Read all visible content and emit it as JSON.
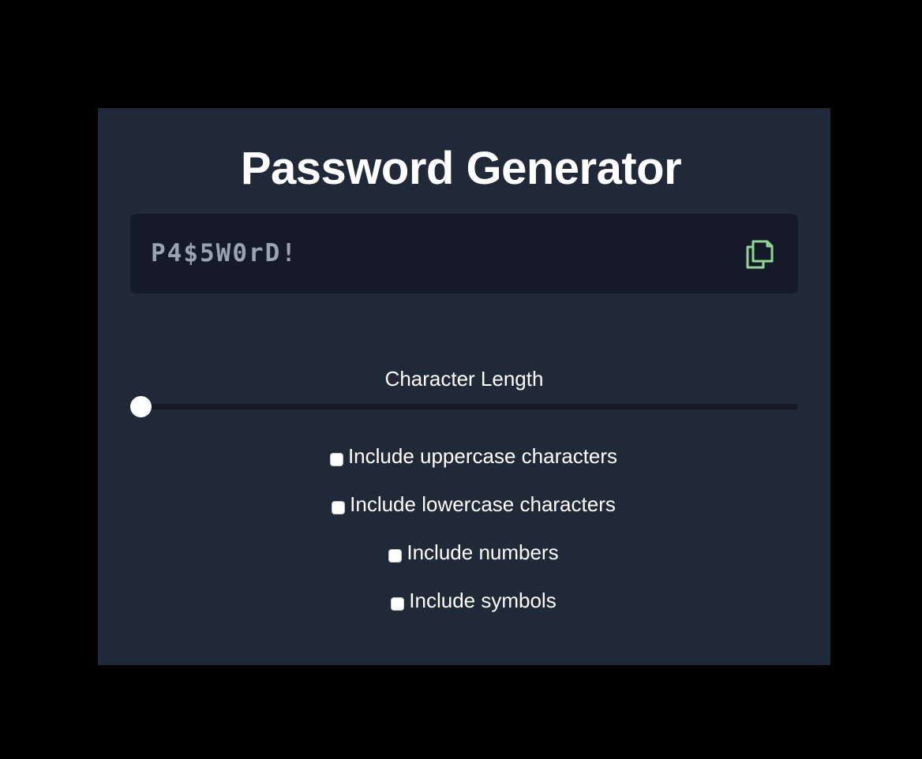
{
  "app": {
    "title": "Password Generator"
  },
  "password": {
    "value": "P4$5W0rD!",
    "copy_icon": "copy-icon",
    "copy_icon_color": "#8fd694"
  },
  "length": {
    "label": "Character Length",
    "value_fraction": 0
  },
  "options": [
    {
      "label": "Include uppercase characters",
      "checked": false
    },
    {
      "label": "Include lowercase characters",
      "checked": false
    },
    {
      "label": "Include numbers",
      "checked": false
    },
    {
      "label": "Include symbols",
      "checked": false
    }
  ],
  "colors": {
    "page_background": "#000000",
    "card_background": "#202938",
    "password_box_background": "#151a29",
    "password_text": "#9aa3b2",
    "accent_green": "#8fd694"
  }
}
